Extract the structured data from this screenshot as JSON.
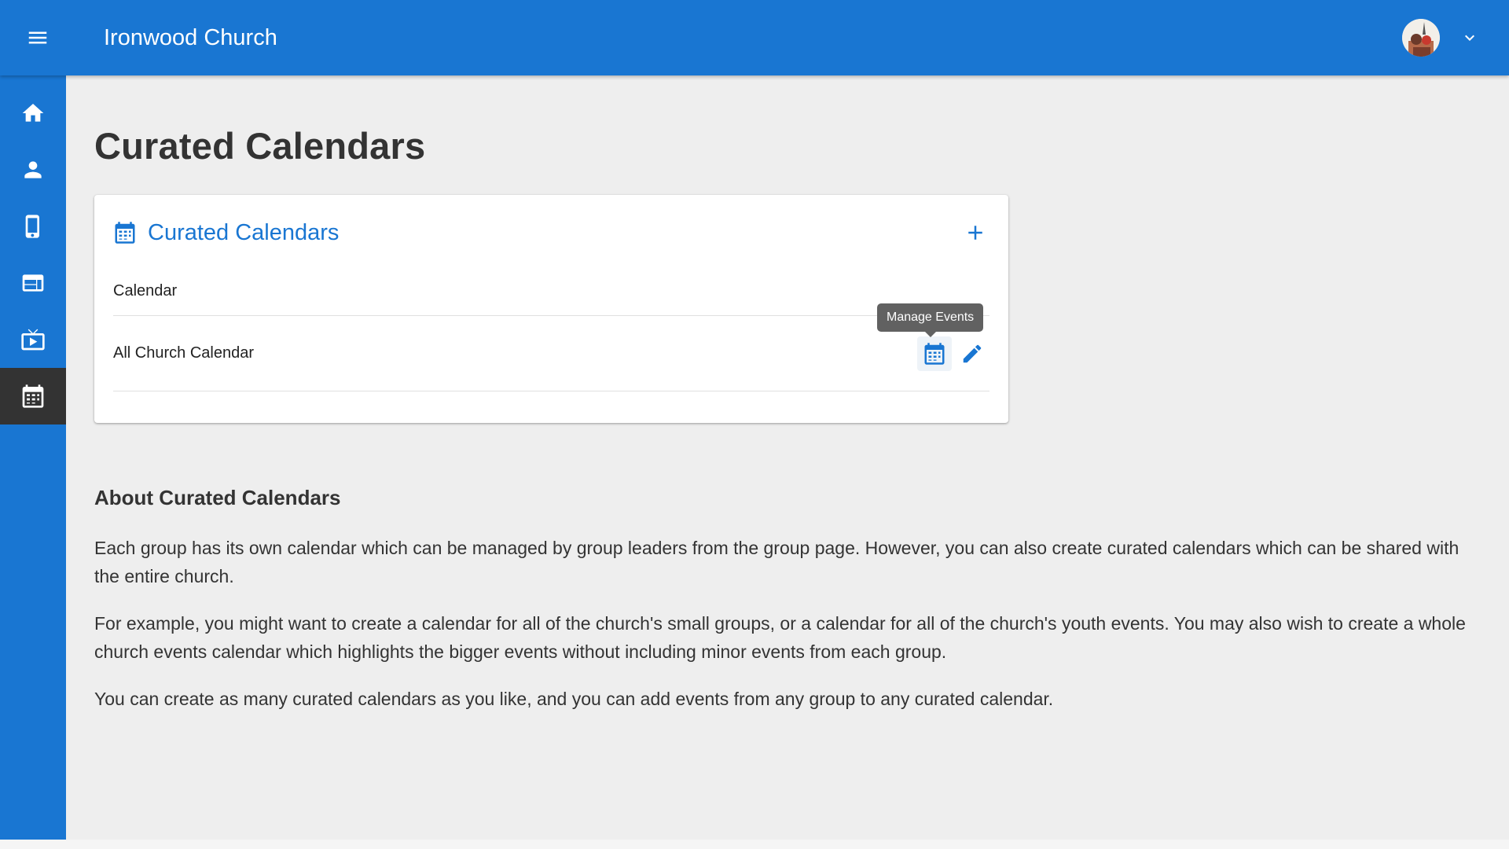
{
  "header": {
    "app_title": "Ironwood Church",
    "menu_icon": "hamburger-menu-icon",
    "avatar_icon": "user-avatar",
    "dropdown_icon": "chevron-down-icon"
  },
  "sidebar": {
    "items": [
      {
        "name": "home",
        "icon": "home-icon",
        "active": false
      },
      {
        "name": "people",
        "icon": "person-icon",
        "active": false
      },
      {
        "name": "mobile",
        "icon": "mobile-phone-icon",
        "active": false
      },
      {
        "name": "website",
        "icon": "web-layout-icon",
        "active": false
      },
      {
        "name": "streaming",
        "icon": "live-tv-icon",
        "active": false
      },
      {
        "name": "calendars",
        "icon": "calendar-icon",
        "active": true
      }
    ]
  },
  "page": {
    "title": "Curated Calendars"
  },
  "card": {
    "title": "Curated Calendars",
    "title_icon": "calendar-icon",
    "add_icon": "plus-icon",
    "column_header": "Calendar",
    "rows": [
      {
        "name": "All Church Calendar",
        "actions": [
          "calendar-icon",
          "edit-pencil-icon"
        ]
      }
    ],
    "tooltip": "Manage Events"
  },
  "about": {
    "heading": "About Curated Calendars",
    "paragraphs": [
      "Each group has its own calendar which can be managed by group leaders from the group page. However, you can also create curated calendars which can be shared with the entire church.",
      "For example, you might want to create a calendar for all of the church's small groups, or a calendar for all of the church's youth events. You may also wish to create a whole church events calendar which highlights the bigger events without including minor events from each group.",
      "You can create as many curated calendars as you like, and you can add events from any group to any curated calendar."
    ]
  },
  "colors": {
    "primary": "#1976d2",
    "sidebar_active": "#333333",
    "background": "#eeeeee",
    "tooltip": "#616161"
  }
}
